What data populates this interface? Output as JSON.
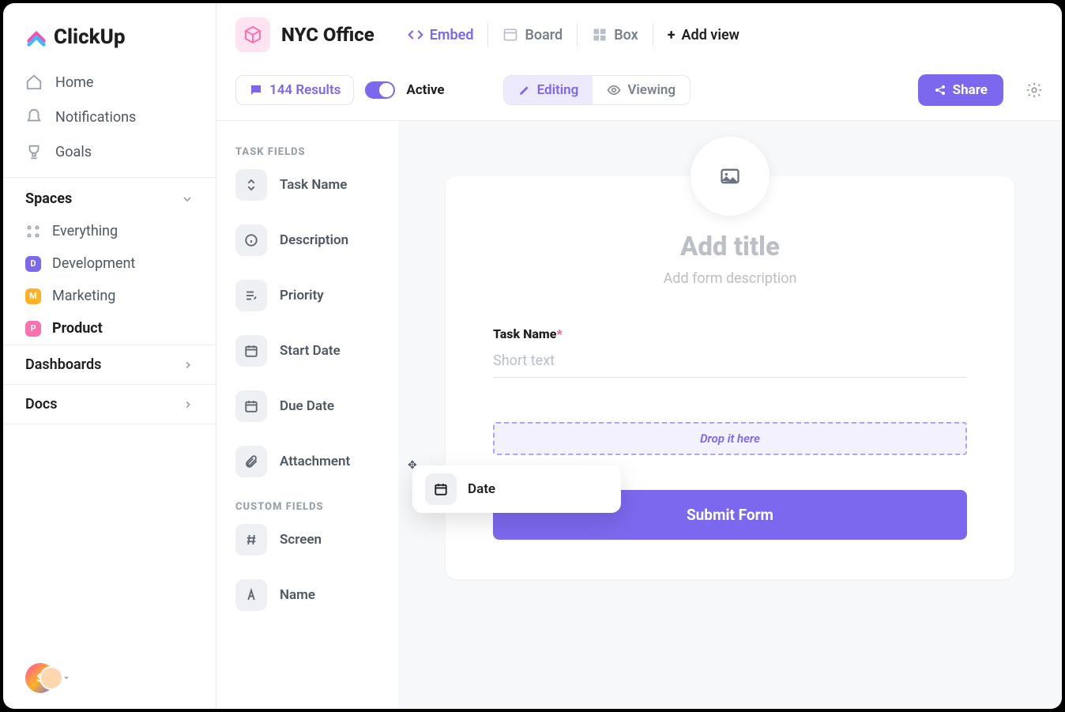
{
  "brand": "ClickUp",
  "sidebar": {
    "nav": [
      {
        "label": "Home"
      },
      {
        "label": "Notifications"
      },
      {
        "label": "Goals"
      }
    ],
    "spaces_header": "Spaces",
    "everything": "Everything",
    "spaces": [
      {
        "initial": "D",
        "label": "Development",
        "color": "#7b68ee"
      },
      {
        "initial": "M",
        "label": "Marketing",
        "color": "#ffb224"
      },
      {
        "initial": "P",
        "label": "Product",
        "color": "#fd71af",
        "bold": true
      }
    ],
    "collapse": [
      {
        "label": "Dashboards"
      },
      {
        "label": "Docs"
      }
    ],
    "avatar_initial": "S"
  },
  "header": {
    "space_name": "NYC Office",
    "views": [
      {
        "label": "Embed",
        "active": true,
        "icon": "code"
      },
      {
        "label": "Board",
        "icon": "board"
      },
      {
        "label": "Box",
        "icon": "box"
      },
      {
        "label": "Add view",
        "icon": "plus"
      }
    ]
  },
  "toolbar": {
    "results": "144 Results",
    "active_label": "Active",
    "modes": [
      {
        "label": "Editing",
        "active": true,
        "icon": "pencil"
      },
      {
        "label": "Viewing",
        "icon": "eye"
      }
    ],
    "share": "Share"
  },
  "fields": {
    "task_header": "TASK FIELDS",
    "task_fields": [
      {
        "label": "Task Name",
        "icon": "updown"
      },
      {
        "label": "Description",
        "icon": "info"
      },
      {
        "label": "Priority",
        "icon": "priority"
      },
      {
        "label": "Start Date",
        "icon": "calendar"
      },
      {
        "label": "Due Date",
        "icon": "calendar"
      },
      {
        "label": "Attachment",
        "icon": "clip"
      }
    ],
    "custom_header": "CUSTOM FIELDS",
    "custom_fields": [
      {
        "label": "Screen",
        "icon": "hash"
      },
      {
        "label": "Name",
        "icon": "type"
      }
    ]
  },
  "form": {
    "title_placeholder": "Add title",
    "desc_placeholder": "Add form description",
    "field1_label": "Task Name",
    "field1_hint": "Short text",
    "drop_hint": "Drop it here",
    "submit": "Submit Form"
  },
  "dragging": {
    "label": "Date"
  }
}
